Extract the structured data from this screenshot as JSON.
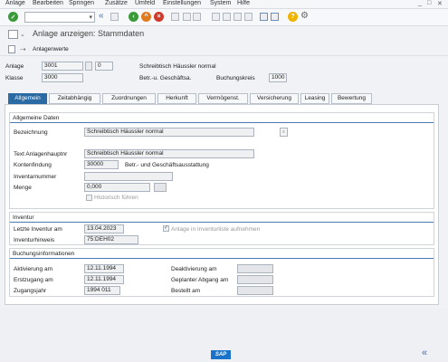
{
  "menu": {
    "items": [
      "Anlage",
      "Bearbeiten",
      "Springen",
      "Zusätze",
      "Umfeld",
      "Einstellungen",
      "System",
      "Hilfe"
    ],
    "window_controls": [
      "_",
      "□",
      "✕"
    ]
  },
  "toolbar": {
    "command_field_value": "",
    "enter_icon": "check-icon",
    "back_icon": "back-icon",
    "exit_icon": "exit-icon",
    "cancel_icon": "cancel-icon"
  },
  "title": {
    "text": "Anlage anzeigen: Stammdaten"
  },
  "subbar": {
    "anlagenwerte_label": "Anlagenwerte"
  },
  "header": {
    "anlage_label": "Anlage",
    "anlage_value": "3001",
    "anlage_sub_value": "0",
    "anlage_desc": "Schreibtisch Häussler normal",
    "klasse_label": "Klasse",
    "klasse_value": "3000",
    "klasse_desc": "Betr.-u. Geschäftsa.",
    "buchungskreis_label": "Buchungskreis",
    "buchungskreis_value": "1000"
  },
  "tabs": [
    "Allgemein",
    "Zeitabhängig",
    "Zuordnungen",
    "Herkunft",
    "Vermögenst.",
    "Versicherung",
    "Leasing",
    "Bewertung"
  ],
  "allgemeine_daten": {
    "heading": "Allgemeine Daten",
    "bezeichnung_label": "Bezeichnung",
    "bezeichnung_value": "Schreibtisch Häussler normal",
    "text_label": "Text Anlagenhauptnr",
    "text_value": "Schreibtisch Häussler normal",
    "kontenfindung_label": "Kontenfindung",
    "kontenfindung_value": "30000",
    "kontenfindung_desc": "Betr.- und Geschäftsausstattung",
    "inventarnummer_label": "Inventarnummer",
    "inventarnummer_value": "",
    "menge_label": "Menge",
    "menge_value": "0,000",
    "historisch_label": "Historisch führen"
  },
  "inventur": {
    "heading": "Inventur",
    "letzte_label": "Letzte Inventur am",
    "letzte_value": "13.04.2023",
    "aufnehmen_label": "Anlage in Inventurliste aufnehmen",
    "hinweis_label": "Inventurhinweis",
    "hinweis_value": "75:DEH02"
  },
  "buchungsinformationen": {
    "heading": "Buchungsinformationen",
    "aktivierung_label": "Aktivierung am",
    "aktivierung_value": "12.11.1994",
    "deaktivierung_label": "Deaktivierung am",
    "deaktivierung_value": "",
    "erstzugang_label": "Erstzugang am",
    "erstzugang_value": "12.11.1994",
    "geplanter_label": "Geplanter Abgang am",
    "geplanter_value": "",
    "zugangsjahr_label": "Zugangsjahr",
    "zugangsjahr_value": "1994 011",
    "bestellt_label": "Bestellt am",
    "bestellt_value": ""
  },
  "statusbar": {
    "logo": "SAP",
    "collapse": "«"
  },
  "colors": {
    "accent": "#2b6ba3",
    "enter_green": "#3a9a3a",
    "exit_orange": "#e07a1f",
    "cancel_red": "#d13a2a"
  }
}
